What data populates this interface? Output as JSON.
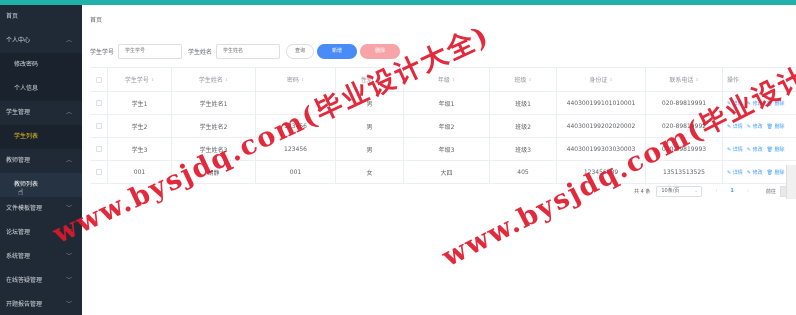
{
  "colors": {
    "topbar": "#20b2aa",
    "sidebar": "#1f2a36",
    "active": "#f0c419",
    "primary": "#4a8cf7",
    "danger": "#f7a4a8",
    "watermark": "#e0182c"
  },
  "sidebar": {
    "items": [
      {
        "label": "首页"
      },
      {
        "label": "个人中心"
      },
      {
        "label": "修改密码"
      },
      {
        "label": "个人信息"
      },
      {
        "label": "学生管理"
      },
      {
        "label": "学生列表"
      },
      {
        "label": "教师管理"
      },
      {
        "label": "教师列表"
      },
      {
        "label": "文件模板管理"
      },
      {
        "label": "论坛管理"
      },
      {
        "label": "系统管理"
      },
      {
        "label": "在线答疑管理"
      },
      {
        "label": "开题报告管理"
      }
    ]
  },
  "breadcrumb": "首页",
  "search": {
    "student_no_label": "学生学号",
    "student_no_placeholder": "学生学号",
    "student_name_label": "学生姓名",
    "student_name_placeholder": "学生姓名",
    "query_label": "查询",
    "add_label": "新增",
    "delete_label": "删除"
  },
  "table": {
    "headers": [
      "学生学号",
      "学生姓名",
      "密码",
      "性别",
      "年级",
      "班级",
      "身份证",
      "联系电话",
      "操作"
    ],
    "rows": [
      [
        "学生1",
        "学生姓名1",
        "",
        "男",
        "年级1",
        "班级1",
        "440300199101010001",
        "020-89819991"
      ],
      [
        "学生2",
        "学生姓名2",
        "123456",
        "男",
        "年级2",
        "班级2",
        "440300199202020002",
        "020-89819992"
      ],
      [
        "学生3",
        "学生姓名3",
        "123456",
        "男",
        "年级3",
        "班级3",
        "440300199303030003",
        "020-89819993"
      ],
      [
        "001",
        "胡静",
        "001",
        "女",
        "大四",
        "405",
        "123456789",
        "13513513525"
      ]
    ],
    "actions": {
      "detail": "详情",
      "edit": "修改",
      "delete": "删除"
    }
  },
  "pagination": {
    "total": "共 4 条",
    "page_size": "10条/页",
    "current_page": "1",
    "goto": "前往"
  },
  "watermark": "www.bysjdq.com(毕业设计大全)"
}
